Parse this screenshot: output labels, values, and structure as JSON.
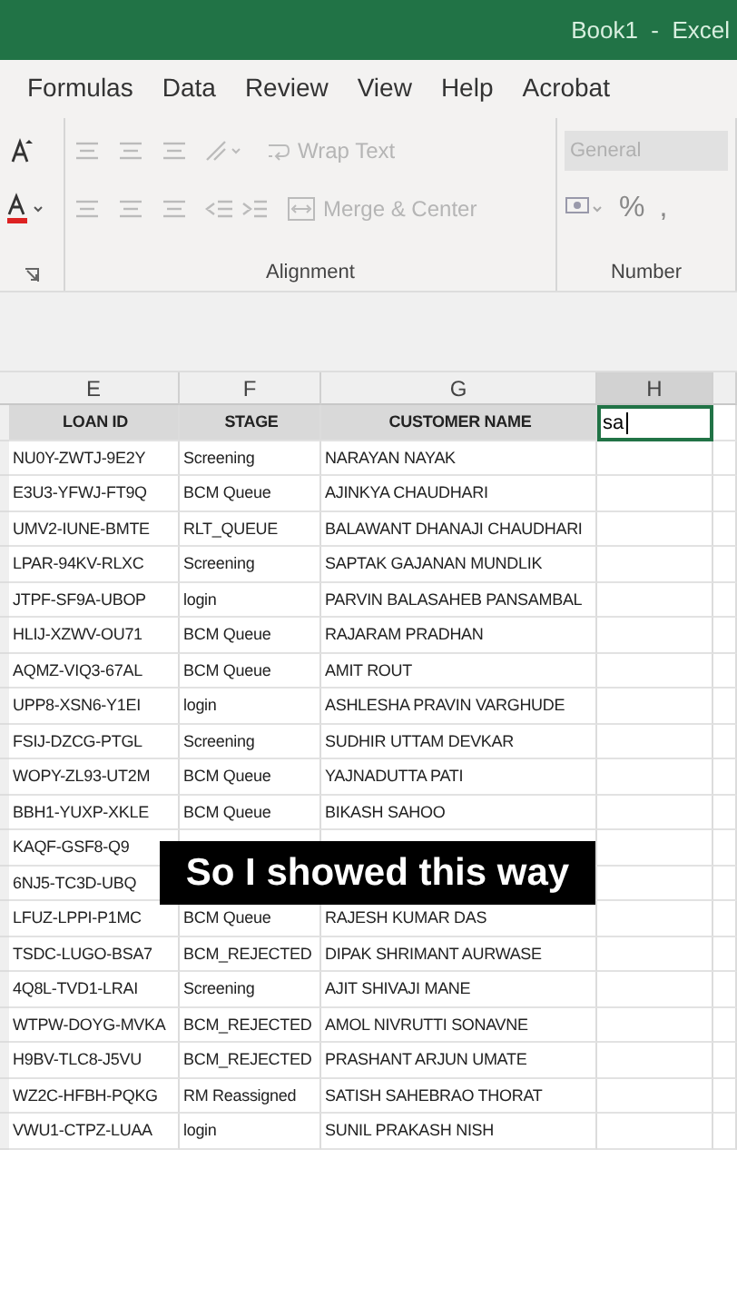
{
  "window": {
    "title": "Book1  -  Excel"
  },
  "ribbon_tabs": [
    {
      "label": "Formulas",
      "selected": false
    },
    {
      "label": "Data",
      "selected": false
    },
    {
      "label": "Review",
      "selected": false
    },
    {
      "label": "View",
      "selected": false
    },
    {
      "label": "Help",
      "selected": false
    },
    {
      "label": "Acrobat",
      "selected": false
    }
  ],
  "ribbon": {
    "alignment": {
      "label": "Alignment",
      "wrap_text": {
        "label": "Wrap Text",
        "disabled": true
      },
      "merge_center": {
        "label": "Merge & Center",
        "disabled": true
      }
    },
    "number": {
      "label": "Number",
      "format": {
        "value": "General",
        "disabled": true
      },
      "percent": "%",
      "comma": ","
    }
  },
  "columns": [
    {
      "label": "E",
      "selected": false
    },
    {
      "label": "F",
      "selected": false
    },
    {
      "label": "G",
      "selected": false
    },
    {
      "label": "H",
      "selected": true
    },
    {
      "selected": false
    }
  ],
  "header_row": [
    "LOAN ID",
    "STAGE",
    "CUSTOMER NAME"
  ],
  "active_cell": {
    "value": "sa"
  },
  "rows": [
    {
      "cells": [
        "NU0Y-ZWTJ-9E2Y",
        "Screening",
        "NARAYAN NAYAK"
      ]
    },
    {
      "cells": [
        "E3U3-YFWJ-FT9Q",
        "BCM Queue",
        "AJINKYA CHAUDHARI"
      ]
    },
    {
      "cells": [
        "UMV2-IUNE-BMTE",
        "RLT_QUEUE",
        "BALAWANT DHANAJI CHAUDHARI"
      ]
    },
    {
      "cells": [
        "LPAR-94KV-RLXC",
        "Screening",
        "SAPTAK GAJANAN MUNDLIK"
      ]
    },
    {
      "cells": [
        "JTPF-SF9A-UBOP",
        "login",
        "PARVIN BALASAHEB PANSAMBAL"
      ]
    },
    {
      "cells": [
        "HLIJ-XZWV-OU71",
        "BCM Queue",
        "RAJARAM PRADHAN"
      ]
    },
    {
      "cells": [
        "AQMZ-VIQ3-67AL",
        "BCM Queue",
        "AMIT ROUT"
      ]
    },
    {
      "cells": [
        "UPP8-XSN6-Y1EI",
        "login",
        "ASHLESHA PRAVIN VARGHUDE"
      ]
    },
    {
      "cells": [
        "FSIJ-DZCG-PTGL",
        "Screening",
        "SUDHIR UTTAM DEVKAR"
      ]
    },
    {
      "cells": [
        "WOPY-ZL93-UT2M",
        "BCM Queue",
        "YAJNADUTTA PATI"
      ]
    },
    {
      "cells": [
        "BBH1-YUXP-XKLE",
        "BCM Queue",
        "BIKASH SAHOO"
      ]
    },
    {
      "cells": [
        "KAQF-GSF8-Q9"
      ]
    },
    {
      "cells": [
        "6NJ5-TC3D-UBQ"
      ]
    },
    {
      "cells": [
        "LFUZ-LPPI-P1MC",
        "BCM Queue",
        "RAJESH KUMAR DAS"
      ]
    },
    {
      "cells": [
        "TSDC-LUGO-BSA7",
        "BCM_REJECTED",
        "DIPAK SHRIMANT AURWASE"
      ]
    },
    {
      "cells": [
        "4Q8L-TVD1-LRAI",
        "Screening",
        "AJIT SHIVAJI MANE"
      ]
    },
    {
      "cells": [
        "WTPW-DOYG-MVKA",
        "BCM_REJECTED",
        "AMOL NIVRUTTI SONAVNE"
      ]
    },
    {
      "cells": [
        "H9BV-TLC8-J5VU",
        "BCM_REJECTED",
        "PRASHANT ARJUN UMATE"
      ]
    },
    {
      "cells": [
        "WZ2C-HFBH-PQKG",
        "RM Reassigned",
        "SATISH SAHEBRAO THORAT"
      ]
    },
    {
      "cells": [
        "VWU1-CTPZ-LUAA",
        "login",
        "SUNIL PRAKASH NISH"
      ]
    }
  ],
  "caption": "So I showed this way"
}
